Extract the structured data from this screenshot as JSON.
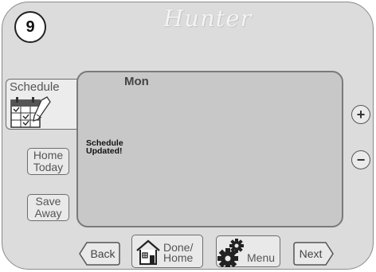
{
  "header": {
    "step_number": "9",
    "brand": "Hunter"
  },
  "sidebar": {
    "schedule_label": "Schedule",
    "home_today_label": [
      "Home",
      "Today"
    ],
    "save_away_label": [
      "Save",
      "Away"
    ]
  },
  "screen": {
    "day": "Mon",
    "message": [
      "Schedule",
      "Updated!"
    ]
  },
  "controls": {
    "plus": "+",
    "minus": "−"
  },
  "footer": {
    "back_label": "Back",
    "done_home_label": [
      "Done/",
      "Home"
    ],
    "menu_label": "Menu",
    "next_label": "Next"
  },
  "icons": {
    "calendar": "calendar-edit-icon",
    "home": "house-icon",
    "menu": "gears-icon"
  }
}
